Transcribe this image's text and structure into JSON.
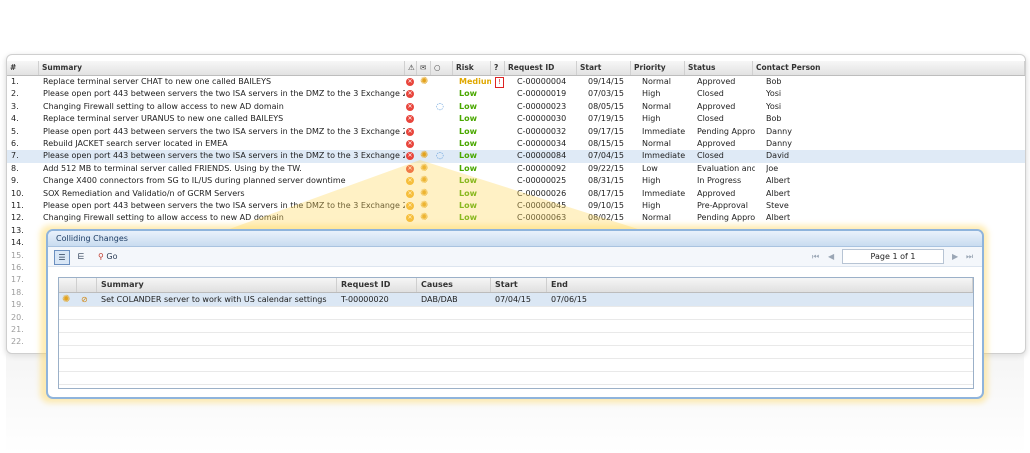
{
  "main": {
    "columns": [
      "#",
      "Summary",
      "Risk",
      "Request ID",
      "Start",
      "Priority",
      "Status",
      "Contact Person"
    ],
    "rows": [
      {
        "n": "1.",
        "summary": "Replace terminal server CHAT to new one called BAILEYS",
        "risk": "Medium",
        "id": "C-00000004",
        "start": "09/14/15",
        "priority": "Normal",
        "status": "Approved",
        "contact": "Bob"
      },
      {
        "n": "2.",
        "summary": "Please open port 443 between servers the two ISA servers in the DMZ to the 3 Exchange 20(",
        "risk": "Low",
        "id": "C-00000019",
        "start": "07/03/15",
        "priority": "High",
        "status": "Closed",
        "contact": "Yosi"
      },
      {
        "n": "3.",
        "summary": "Changing Firewall setting to allow access to new AD domain",
        "risk": "Low",
        "id": "C-00000023",
        "start": "08/05/15",
        "priority": "Normal",
        "status": "Approved",
        "contact": "Yosi"
      },
      {
        "n": "4.",
        "summary": "Replace terminal server URANUS to new one called BAILEYS",
        "risk": "Low",
        "id": "C-00000030",
        "start": "07/19/15",
        "priority": "High",
        "status": "Closed",
        "contact": "Bob"
      },
      {
        "n": "5.",
        "summary": "Please open port 443 between servers the two ISA servers in the DMZ to the 3 Exchange 20(",
        "risk": "Low",
        "id": "C-00000032",
        "start": "09/17/15",
        "priority": "Immediate",
        "status": "Pending Approv",
        "contact": "Danny"
      },
      {
        "n": "6.",
        "summary": "Rebuild JACKET search server located in EMEA",
        "risk": "Low",
        "id": "C-00000034",
        "start": "08/15/15",
        "priority": "Normal",
        "status": "Approved",
        "contact": "Danny"
      },
      {
        "n": "7.",
        "summary": "Please open port 443 between servers the two ISA servers in the DMZ to the 3 Exchange 20(",
        "risk": "Low",
        "id": "C-00000084",
        "start": "07/04/15",
        "priority": "Immediate",
        "status": "Closed",
        "contact": "David"
      },
      {
        "n": "8.",
        "summary": "Add 512 MB to terminal server called FRIENDS. Using by the TW.",
        "risk": "Low",
        "id": "C-00000092",
        "start": "09/22/15",
        "priority": "Low",
        "status": "Evaluation and",
        "contact": "Joe"
      },
      {
        "n": "9.",
        "summary": "Change X400 connectors from SG to IL/US during planned server downtime",
        "risk": "Low",
        "id": "C-00000025",
        "start": "08/31/15",
        "priority": "High",
        "status": "In Progress",
        "contact": "Albert"
      },
      {
        "n": "10.",
        "summary": "SOX Remediation and Validatio/n of GCRM Servers",
        "risk": "Low",
        "id": "C-00000026",
        "start": "08/17/15",
        "priority": "Immediate",
        "status": "Approved",
        "contact": "Albert"
      },
      {
        "n": "11.",
        "summary": "Please open port 443 between servers the two ISA servers in the DMZ to the 3 Exchange 20(",
        "risk": "Low",
        "id": "C-00000045",
        "start": "09/10/15",
        "priority": "High",
        "status": "Pre-Approval",
        "contact": "Steve"
      },
      {
        "n": "12.",
        "summary": "Changing Firewall setting to allow access to new AD domain",
        "risk": "Low",
        "id": "C-00000063",
        "start": "08/02/15",
        "priority": "Normal",
        "status": "Pending Approv",
        "contact": "Albert"
      },
      {
        "n": "13.",
        "summary": "",
        "risk": "",
        "id": "",
        "start": "",
        "priority": "",
        "status": "",
        "contact": ""
      },
      {
        "n": "14.",
        "summary": "",
        "risk": "",
        "id": "",
        "start": "",
        "priority": "",
        "status": "",
        "contact": ""
      },
      {
        "n": "15.",
        "summary": "",
        "risk": "",
        "id": "",
        "start": "",
        "priority": "",
        "status": "",
        "contact": ""
      },
      {
        "n": "16.",
        "summary": "",
        "risk": "",
        "id": "",
        "start": "",
        "priority": "",
        "status": "",
        "contact": ""
      },
      {
        "n": "17.",
        "summary": "",
        "risk": "",
        "id": "",
        "start": "",
        "priority": "",
        "status": "",
        "contact": ""
      },
      {
        "n": "18.",
        "summary": "",
        "risk": "",
        "id": "",
        "start": "",
        "priority": "",
        "status": "",
        "contact": ""
      },
      {
        "n": "19.",
        "summary": "",
        "risk": "",
        "id": "",
        "start": "",
        "priority": "",
        "status": "",
        "contact": ""
      },
      {
        "n": "20.",
        "summary": "",
        "risk": "",
        "id": "",
        "start": "",
        "priority": "",
        "status": "",
        "contact": ""
      },
      {
        "n": "21.",
        "summary": "",
        "risk": "",
        "id": "",
        "start": "",
        "priority": "",
        "status": "",
        "contact": ""
      },
      {
        "n": "22.",
        "summary": "",
        "risk": "",
        "id": "",
        "start": "",
        "priority": "",
        "status": "",
        "contact": ""
      }
    ]
  },
  "dialog": {
    "title": "Colliding Changes",
    "go_label": "Go",
    "page_label": "Page 1 of 1",
    "columns": [
      "Summary",
      "Request ID",
      "Causes",
      "Start",
      "End"
    ],
    "rows": [
      {
        "summary": "Set COLANDER server to work with US calendar settings",
        "id": "T-00000020",
        "causes": "DAB/DAB",
        "start": "07/04/15",
        "end": "07/06/15"
      }
    ]
  },
  "colors": {
    "accent": "#8fb4dc",
    "risk_low": "#4aa800",
    "risk_medium": "#e0a800",
    "highlight": "#ffd65a"
  }
}
